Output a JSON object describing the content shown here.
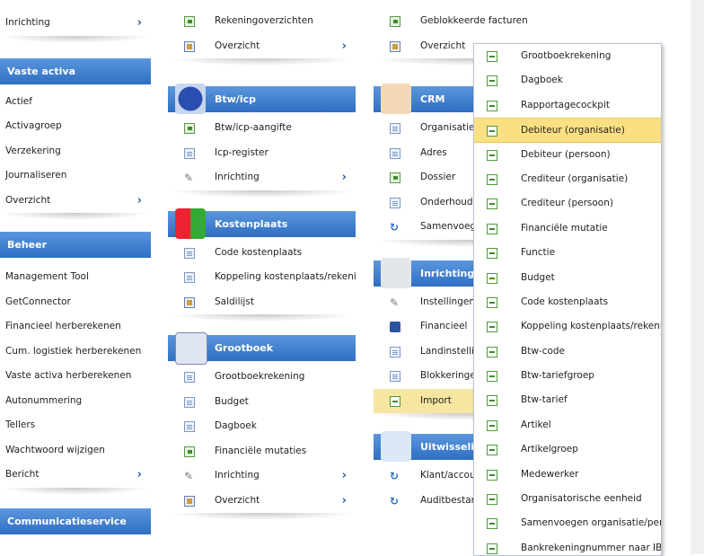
{
  "col1": {
    "top_item": "Inrichting",
    "vaste_activa": {
      "title": "Vaste activa",
      "items": [
        "Actief",
        "Activagroep",
        "Verzekering",
        "Journaliseren",
        "Overzicht"
      ]
    },
    "beheer": {
      "title": "Beheer",
      "items": [
        "Management Tool",
        "GetConnector",
        "Financieel herberekenen",
        "Cum. logistiek herberekenen",
        "Vaste activa herberekenen",
        "Autonummering",
        "Tellers",
        "Wachtwoord wijzigen",
        "Bericht"
      ]
    },
    "communicatie": {
      "title": "Communicatieservice"
    }
  },
  "col2": {
    "top_items": [
      "Rekeningoverzichten",
      "Overzicht"
    ],
    "btw": {
      "title": "Btw/icp",
      "items": [
        "Btw/icp-aangifte",
        "Icp-register",
        "Inrichting"
      ]
    },
    "kostenplaats": {
      "title": "Kostenplaats",
      "items": [
        "Code kostenplaats",
        "Koppeling kostenplaats/rekening",
        "Saldilijst"
      ]
    },
    "grootboek": {
      "title": "Grootboek",
      "items": [
        "Grootboekrekening",
        "Budget",
        "Dagboek",
        "Financiële mutaties",
        "Inrichting",
        "Overzicht"
      ]
    }
  },
  "col3": {
    "top_items": [
      "Geblokkeerde facturen",
      "Overzicht"
    ],
    "crm": {
      "title": "CRM",
      "items": [
        "Organisatie/",
        "Adres",
        "Dossier",
        "Onderhoud t",
        "Samenvoege"
      ]
    },
    "inrichting": {
      "title": "Inrichting",
      "items": [
        "Instellingen a",
        "Financieel",
        "Landinstellin",
        "Blokkeringen",
        "Import"
      ]
    },
    "uitwisseling": {
      "title": "Uitwisselin",
      "items": [
        "Klant/accour",
        "Auditbestan"
      ]
    }
  },
  "menu": {
    "items": [
      "Grootboekrekening",
      "Dagboek",
      "Rapportagecockpit",
      "Debiteur (organisatie)",
      "Debiteur (persoon)",
      "Crediteur (organisatie)",
      "Crediteur (persoon)",
      "Financiële mutatie",
      "Functie",
      "Budget",
      "Code kostenplaats",
      "Koppeling kostenplaats/rekening",
      "Btw-code",
      "Btw-tariefgroep",
      "Btw-tarief",
      "Artikel",
      "Artikelgroep",
      "Medewerker",
      "Organisatorische eenheid",
      "Samenvoegen organisatie/pers.",
      "Bankrekeningnummer naar IBAN"
    ],
    "selected": "Debiteur (organisatie)"
  },
  "colors": {
    "header_blue": "#3b7ac9",
    "selected": "#fbe083"
  },
  "chevron": "›"
}
